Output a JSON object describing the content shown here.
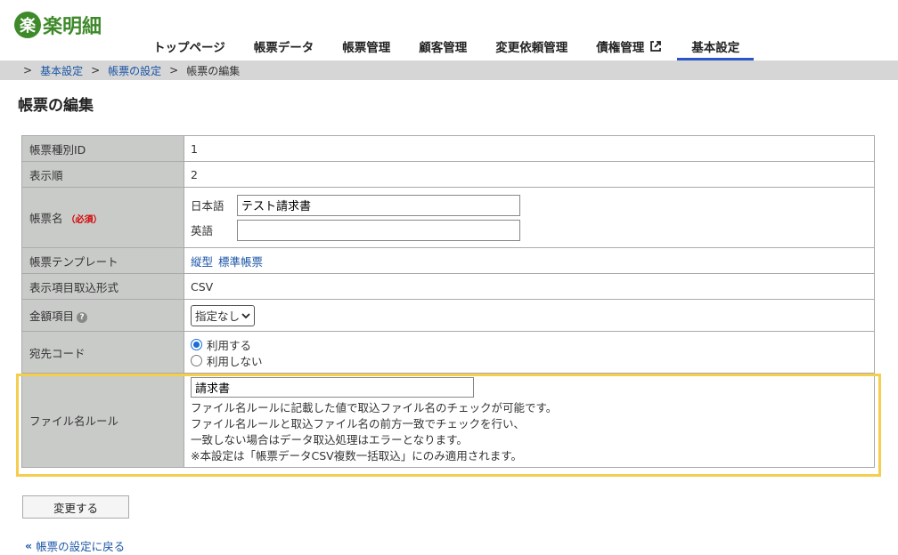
{
  "header": {
    "logo_mark": "楽",
    "logo_text": "楽明細",
    "nav": [
      {
        "label": "トップページ"
      },
      {
        "label": "帳票データ"
      },
      {
        "label": "帳票管理"
      },
      {
        "label": "顧客管理"
      },
      {
        "label": "変更依頼管理"
      },
      {
        "label": "債権管理"
      },
      {
        "label": "基本設定",
        "active": true
      }
    ]
  },
  "breadcrumb": {
    "sep": ">",
    "items": [
      "基本設定",
      "帳票の設定",
      "帳票の編集"
    ]
  },
  "page_title": "帳票の編集",
  "form": {
    "rows": {
      "type_id": {
        "label": "帳票種別ID",
        "value": "1"
      },
      "order": {
        "label": "表示順",
        "value": "2"
      },
      "name": {
        "label": "帳票名",
        "required": "（必須）",
        "ja_label": "日本語",
        "ja_value": "テスト請求書",
        "en_label": "英語",
        "en_value": ""
      },
      "template": {
        "label": "帳票テンプレート",
        "link1": "縦型",
        "link2": "標準帳票"
      },
      "import_format": {
        "label": "表示項目取込形式",
        "value": "CSV"
      },
      "amount": {
        "label": "金額項目",
        "help_icon": "?",
        "selected": "指定なし"
      },
      "address_code": {
        "label": "宛先コード",
        "option_use": "利用する",
        "option_nouse": "利用しない"
      },
      "file_rule": {
        "label": "ファイル名ルール",
        "value": "請求書",
        "desc": [
          "ファイル名ルールに記載した値で取込ファイル名のチェックが可能です。",
          "ファイル名ルールと取込ファイル名の前方一致でチェックを行い、",
          "一致しない場合はデータ取込処理はエラーとなります。",
          "※本設定は「帳票データCSV複数一括取込」にのみ適用されます。"
        ]
      }
    }
  },
  "actions": {
    "submit": "変更する",
    "back_icon": "«",
    "back_link": "帳票の設定に戻る"
  },
  "colors": {
    "brand": "#3e8a2a",
    "nav_active": "#2a56c6",
    "link": "#1a55a6",
    "highlight": "#f5cd4f",
    "required": "#d40000"
  }
}
